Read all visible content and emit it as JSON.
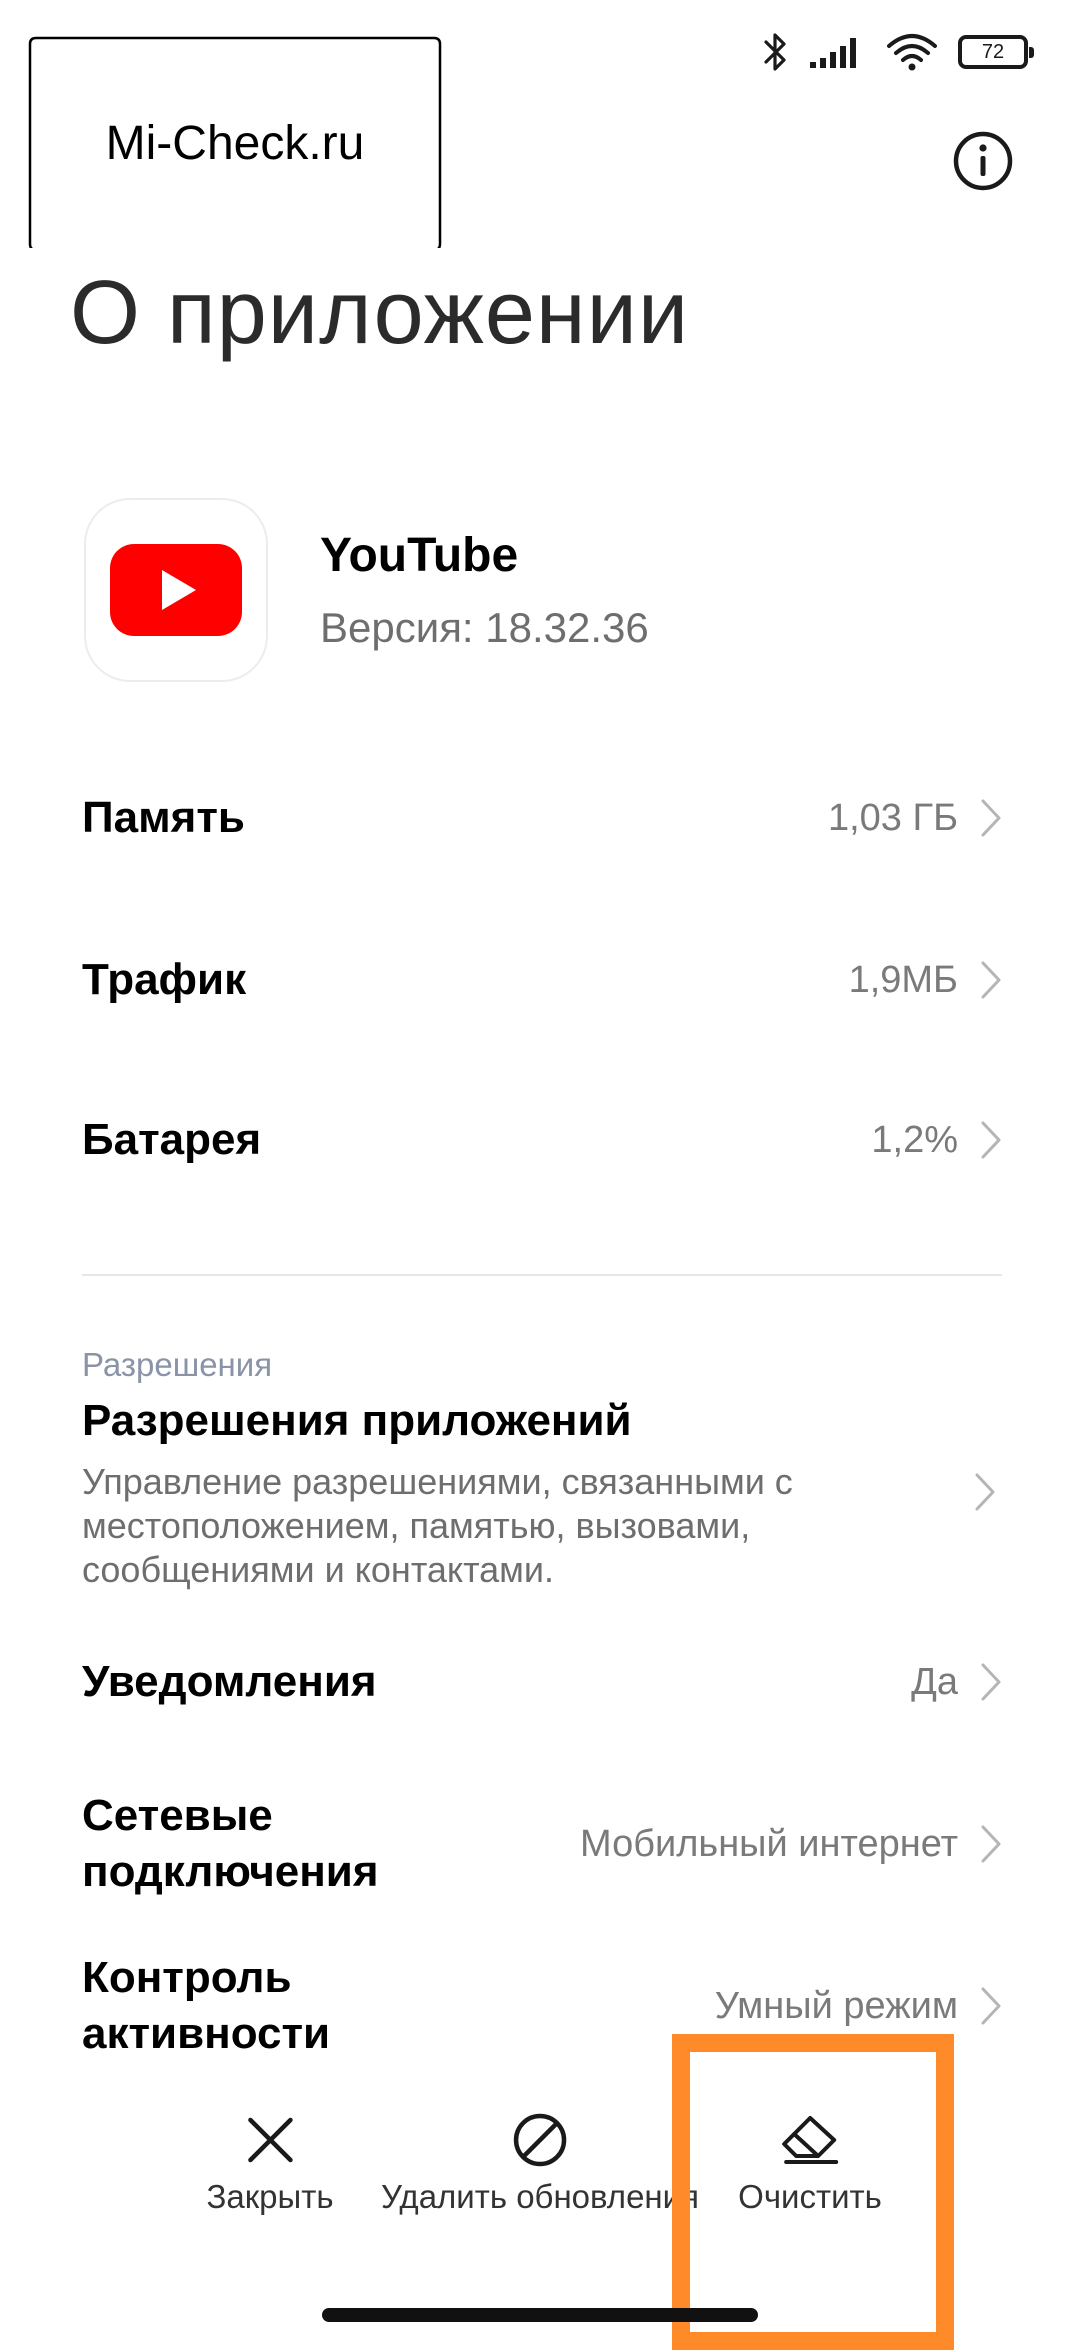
{
  "status_bar": {
    "battery_level": "72",
    "icons": [
      "bluetooth-icon",
      "signal-icon",
      "wifi-icon",
      "battery-icon"
    ]
  },
  "watermark": {
    "text": "Mi-Check.ru"
  },
  "page": {
    "title": "О приложении"
  },
  "app": {
    "name": "YouTube",
    "version": "Версия: 18.32.36",
    "icon": "youtube-logo",
    "brand_color": "#ff0000"
  },
  "rows": [
    {
      "title": "Память",
      "value": "1,03 ГБ"
    },
    {
      "title": "Трафик",
      "value": "1,9МБ"
    },
    {
      "title": "Батарея",
      "value": "1,2%"
    }
  ],
  "permissions": {
    "section_label": "Разрешения",
    "title": "Разрешения приложений",
    "description": "Управление разрешениями, связанными с местоположением, памятью, вызовами, сообщениями и контактами."
  },
  "settings_rows": [
    {
      "title": "Уведомления",
      "value": "Да"
    },
    {
      "title": "Сетевые подключения",
      "value": "Мобильный интернет"
    },
    {
      "title": "Контроль активности",
      "value": "Умный режим"
    }
  ],
  "actions": [
    {
      "label": "Закрыть",
      "icon": "close-icon"
    },
    {
      "label": "Удалить обновления",
      "icon": "block-icon"
    },
    {
      "label": "Очистить",
      "icon": "eraser-icon"
    }
  ],
  "highlight_color": "#ff8a2a"
}
